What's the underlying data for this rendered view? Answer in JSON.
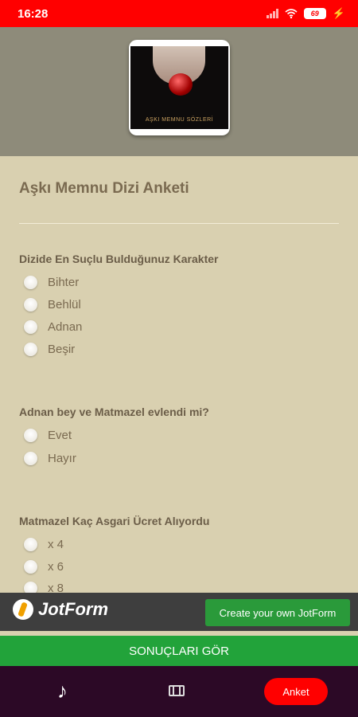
{
  "status_bar": {
    "time": "16:28",
    "battery": "69"
  },
  "header": {
    "logo_caption": "AŞKI MEMNU SÖZLERİ"
  },
  "form": {
    "title": "Aşkı Memnu Dizi Anketi",
    "questions": [
      {
        "label": "Dizide En Suçlu Bulduğunuz Karakter",
        "options": [
          "Bihter",
          "Behlül",
          "Adnan",
          "Beşir"
        ]
      },
      {
        "label": "Adnan bey ve Matmazel evlendi mi?",
        "options": [
          "Evet",
          "Hayır"
        ]
      },
      {
        "label": "Matmazel Kaç Asgari Ücret Alıyordu",
        "options": [
          "x 4",
          "x 6",
          "x 8"
        ]
      }
    ]
  },
  "jotform": {
    "brand": "JotForm",
    "cta": "Create your own JotForm"
  },
  "results_button": "SONUÇLARI GÖR",
  "bottom_nav": {
    "anket": "Anket",
    "music_icon": "music-note-icon",
    "film_icon": "film-icon"
  },
  "colors": {
    "status_bar": "#ff0000",
    "header": "#8e8b7a",
    "form_bg": "#d9d0b0",
    "green": "#22a33a",
    "nav_bg": "#2c0926"
  }
}
